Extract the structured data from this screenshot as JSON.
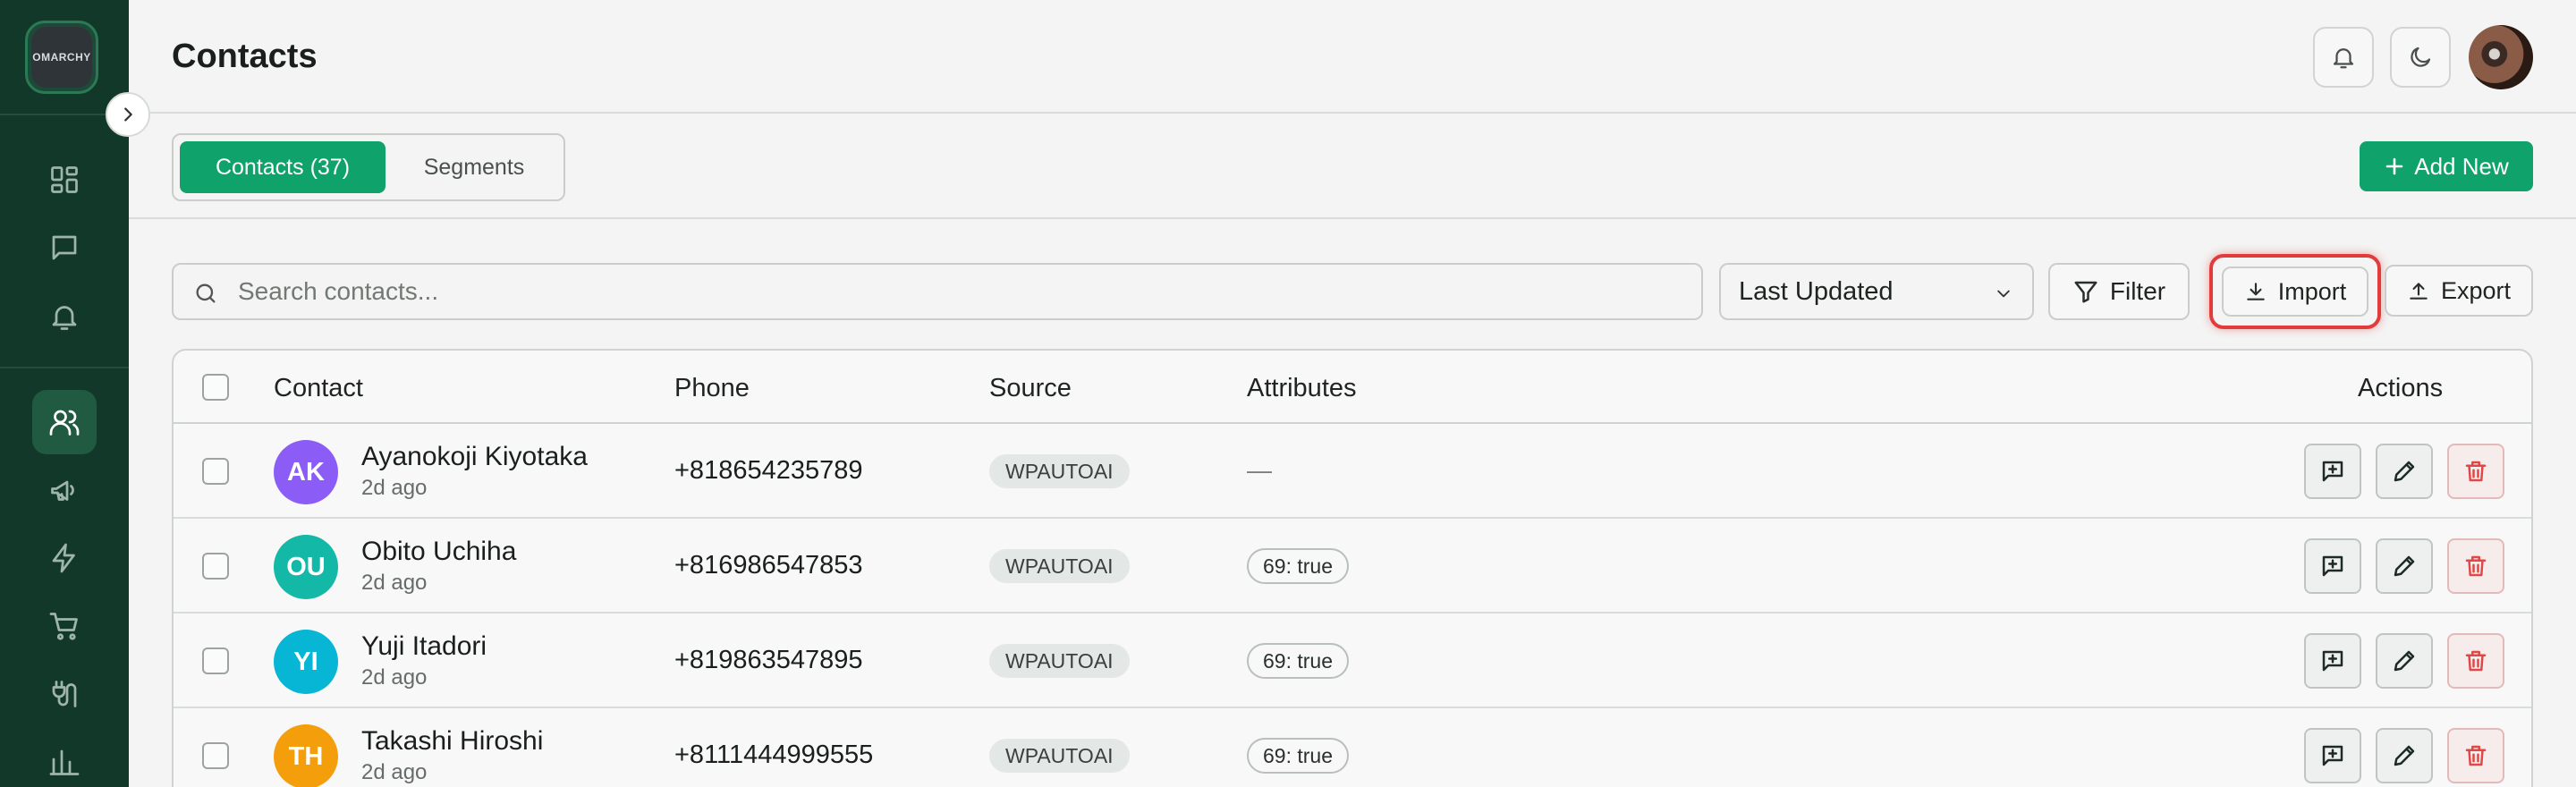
{
  "app": {
    "logo_text": "OMARCHY"
  },
  "sidebar": {
    "items": [
      {
        "name": "dashboard",
        "icon": "grid-icon",
        "active": false
      },
      {
        "name": "messages",
        "icon": "chat-icon",
        "active": false
      },
      {
        "name": "notifications",
        "icon": "bell-icon",
        "active": false
      },
      {
        "name": "contacts",
        "icon": "users-icon",
        "active": true
      },
      {
        "name": "campaigns",
        "icon": "megaphone-icon",
        "active": false
      },
      {
        "name": "automations",
        "icon": "bolt-icon",
        "active": false
      },
      {
        "name": "commerce",
        "icon": "cart-icon",
        "active": false
      },
      {
        "name": "integrations",
        "icon": "plug-icon",
        "active": false
      },
      {
        "name": "analytics",
        "icon": "bar-chart-icon",
        "active": false
      }
    ]
  },
  "header": {
    "title": "Contacts"
  },
  "tabs": {
    "contacts_label": "Contacts (37)",
    "segments_label": "Segments"
  },
  "actions": {
    "add_new_label": "Add New"
  },
  "toolbar": {
    "search_placeholder": "Search contacts...",
    "sort_value": "Last Updated",
    "filter_label": "Filter",
    "import_label": "Import",
    "export_label": "Export"
  },
  "table": {
    "columns": {
      "contact": "Contact",
      "phone": "Phone",
      "source": "Source",
      "attributes": "Attributes",
      "actions": "Actions"
    },
    "rows": [
      {
        "initials": "AK",
        "avatar_color": "#8b5cf6",
        "name": "Ayanokoji Kiyotaka",
        "updated": "2d ago",
        "phone": "+818654235789",
        "source": "WPAUTOAI",
        "attribute": "—"
      },
      {
        "initials": "OU",
        "avatar_color": "#14b8a6",
        "name": "Obito Uchiha",
        "updated": "2d ago",
        "phone": "+816986547853",
        "source": "WPAUTOAI",
        "attribute": "69: true"
      },
      {
        "initials": "YI",
        "avatar_color": "#06b6d4",
        "name": "Yuji Itadori",
        "updated": "2d ago",
        "phone": "+819863547895",
        "source": "WPAUTOAI",
        "attribute": "69: true"
      },
      {
        "initials": "TH",
        "avatar_color": "#f59e0b",
        "name": "Takashi Hiroshi",
        "updated": "2d ago",
        "phone": "+8111444999555",
        "source": "WPAUTOAI",
        "attribute": "69: true"
      }
    ]
  },
  "colors": {
    "sidebar_bg": "#12382a",
    "accent": "#0fa36b",
    "highlight": "#e23b3b",
    "delete": "#e04848"
  }
}
